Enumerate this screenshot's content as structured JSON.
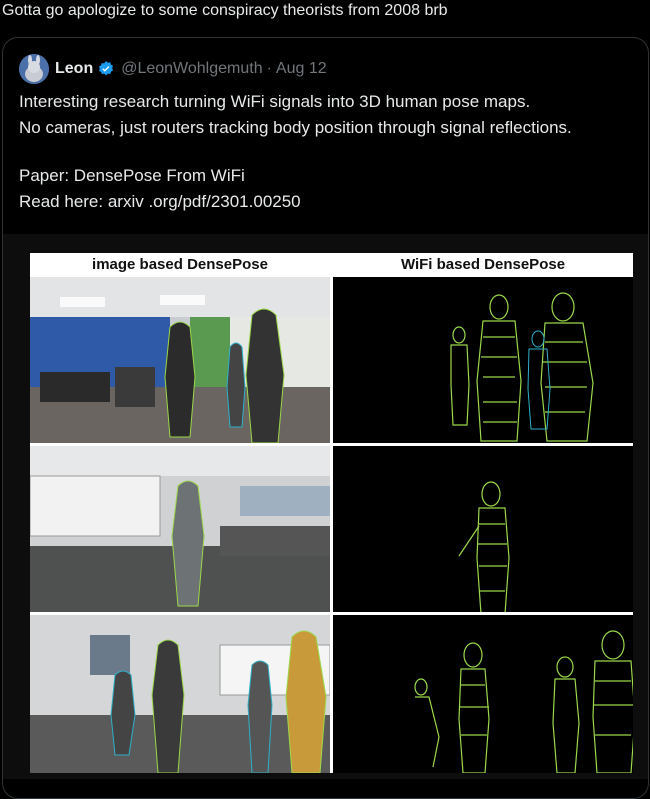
{
  "post": {
    "text": "Gotta go apologize to some conspiracy theorists from 2008 brb"
  },
  "quoted": {
    "author_name": "Leon",
    "handle": "@LeonWohlgemuth",
    "separator": "·",
    "date": "Aug 12",
    "lines": [
      "Interesting research turning WiFi signals into 3D human pose maps.",
      "No cameras, just routers tracking body position through signal reflections.",
      "Paper: DensePose From WiFi",
      "Read here: arxiv .org/pdf/2301.00250"
    ],
    "figure": {
      "left_header": "image based DensePose",
      "right_header": "WiFi based DensePose"
    }
  },
  "colors": {
    "mesh": "#9bd84a",
    "mesh_alt": "#2fb0c8",
    "verified": "#1d9bf0"
  }
}
